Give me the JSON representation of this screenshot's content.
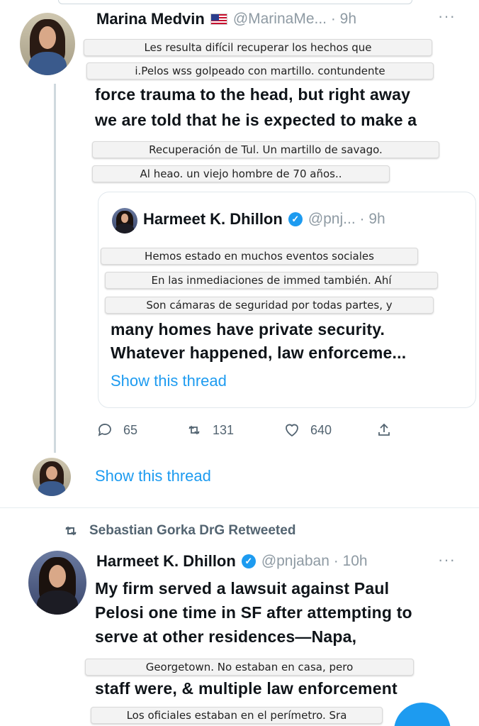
{
  "tweet1": {
    "author_name": "Marina Medvin",
    "handle_time": "@MarinaMe... · 9h",
    "text_line1": "force trauma to the head, but right away",
    "text_line2": "we are told that he is expected to make a",
    "reply_count": "65",
    "retweet_count": "131",
    "like_count": "640",
    "show_thread": "Show this thread"
  },
  "quote": {
    "author_name": "Harmeet K. Dhillon",
    "handle_time": "@pnj... · 9h",
    "text_line1": "many homes have private security.",
    "text_line2": "Whatever happened, law enforceme...",
    "show_thread": "Show this thread"
  },
  "tweet2": {
    "retweeted_by": "Sebastian Gorka DrG Retweeted",
    "author_name": "Harmeet K. Dhillon",
    "handle_time": "@pnjaban · 10h",
    "text_line1": "My firm served a lawsuit against Paul",
    "text_line2": "Pelosi one time in SF after attempting to",
    "text_line3": "serve at other residences—Napa,",
    "text_line4": "staff were, & multiple law enforcement"
  },
  "captions": [
    "Les resulta difícil recuperar los hechos que",
    "i.Pelos wss golpeado con martillo. contundente",
    "Recuperación de Tul. Un martillo de savago.",
    "Al heao. un viejo hombre de 70 años..",
    "Hemos estado en muchos eventos sociales",
    "En las inmediaciones de immed también. Ahí",
    "Son cámaras de seguridad por todas partes, y",
    "Georgetown. No estaban en casa, pero",
    "Los oficiales estaban en el perímetro. Sra"
  ],
  "colors": {
    "link": "#1d9bf0",
    "muted": "#8e9aa3",
    "text": "#0f1419"
  }
}
